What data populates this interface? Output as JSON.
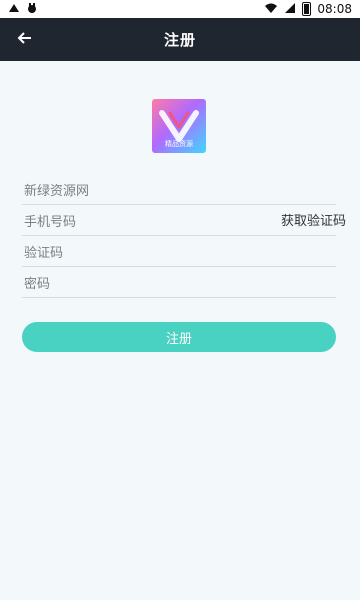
{
  "status_bar": {
    "time": "08:08"
  },
  "header": {
    "title": "注册"
  },
  "logo": {
    "text": "精品资源"
  },
  "form": {
    "fields": [
      {
        "label": "新绿资源网"
      },
      {
        "label": "手机号码"
      },
      {
        "label": "验证码"
      },
      {
        "label": "密码"
      }
    ],
    "get_code_label": "获取验证码"
  },
  "submit_label": "注册",
  "colors": {
    "appbar": "#1f2630",
    "button": "#49d2c2",
    "background": "#f3f8fb"
  }
}
